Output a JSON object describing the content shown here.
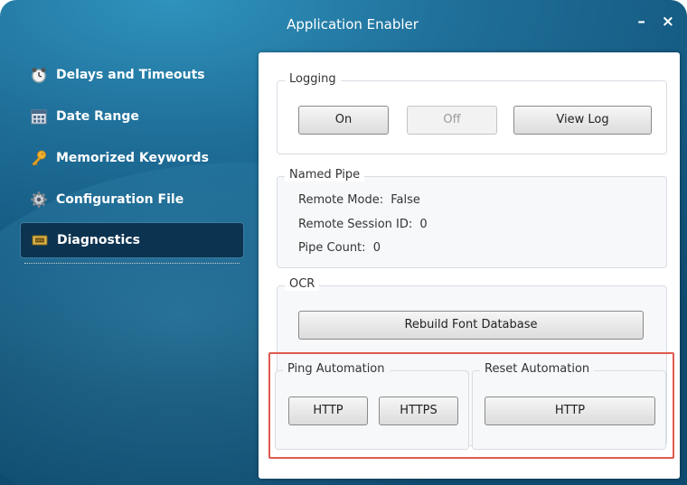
{
  "window": {
    "title": "Application Enabler",
    "minimize": "–",
    "close": "×"
  },
  "nav": [
    {
      "label": "Delays and Timeouts",
      "icon": "clock-icon"
    },
    {
      "label": "Date Range",
      "icon": "calendar-icon"
    },
    {
      "label": "Memorized Keywords",
      "icon": "key-icon"
    },
    {
      "label": "Configuration File",
      "icon": "gear-icon"
    },
    {
      "label": "Diagnostics",
      "icon": "ticket-icon",
      "active": true
    }
  ],
  "logging": {
    "title": "Logging",
    "on": "On",
    "off": "Off",
    "view_log": "View Log"
  },
  "named_pipe": {
    "title": "Named Pipe",
    "remote_mode_label": "Remote Mode:",
    "remote_mode_value": "False",
    "remote_session_label": "Remote Session ID:",
    "remote_session_value": "0",
    "pipe_count_label": "Pipe Count:",
    "pipe_count_value": "0"
  },
  "ocr": {
    "title": "OCR",
    "rebuild": "Rebuild Font Database"
  },
  "ping": {
    "title": "Ping Automation",
    "http": "HTTP",
    "https": "HTTPS"
  },
  "reset": {
    "title": "Reset Automation",
    "http": "HTTP"
  },
  "colors": {
    "highlight": "#e05a4e",
    "window_bg": "#1f6f99"
  }
}
